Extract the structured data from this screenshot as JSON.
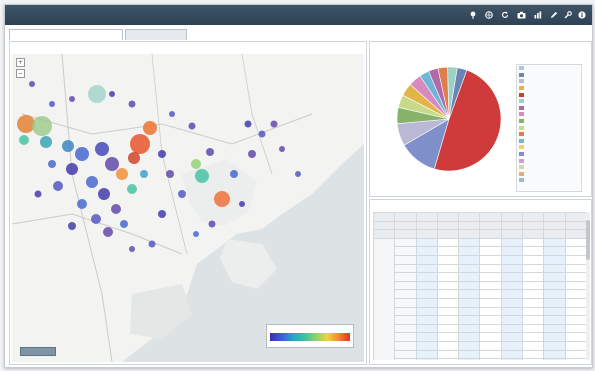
{
  "titlebar": {
    "title": "",
    "tools": [
      {
        "icon": "pin-icon",
        "label": ""
      },
      {
        "icon": "globe-icon",
        "label": ""
      },
      {
        "icon": "refresh-icon",
        "label": ""
      },
      {
        "icon": "camera-icon",
        "label": ""
      },
      {
        "icon": "bar-chart-icon",
        "label": ""
      },
      {
        "icon": "pencil-icon",
        "label": ""
      },
      {
        "icon": "wrench-icon",
        "label": ""
      },
      {
        "icon": "info-icon",
        "label": ""
      }
    ]
  },
  "tabs": [
    {
      "label": ""
    },
    {
      "label": ""
    }
  ],
  "map_panel": {
    "title": "",
    "attribution": "",
    "legend": {
      "min": "",
      "max": ""
    }
  },
  "pie_panel": {
    "title": "",
    "slices": [
      {
        "value": 49,
        "color": "#cf3b3b"
      },
      {
        "value": 12,
        "color": "#7f8fc9"
      },
      {
        "value": 7,
        "color": "#b9b9d6"
      },
      {
        "value": 5,
        "color": "#86b36a"
      },
      {
        "value": 4,
        "color": "#c9d98a"
      },
      {
        "value": 4,
        "color": "#e3b44a"
      },
      {
        "value": 4,
        "color": "#d88ac0"
      },
      {
        "value": 3,
        "color": "#6fb6d6"
      },
      {
        "value": 3,
        "color": "#b06aa8"
      },
      {
        "value": 3,
        "color": "#e07d4c"
      },
      {
        "value": 3,
        "color": "#9fd0c6"
      },
      {
        "value": 3,
        "color": "#6a84b8"
      }
    ],
    "legend": [
      {
        "label": "",
        "color": "#a9c7e8"
      },
      {
        "label": "",
        "color": "#6a84b8"
      },
      {
        "label": "",
        "color": "#b9b9d6"
      },
      {
        "label": "",
        "color": "#e3b44a"
      },
      {
        "label": "",
        "color": "#cf3b3b"
      },
      {
        "label": "",
        "color": "#9fd0c6"
      },
      {
        "label": "",
        "color": "#b06aa8"
      },
      {
        "label": "",
        "color": "#d88ac0"
      },
      {
        "label": "",
        "color": "#86b36a"
      },
      {
        "label": "",
        "color": "#c9d98a"
      },
      {
        "label": "",
        "color": "#e07d4c"
      },
      {
        "label": "",
        "color": "#6fb6d6"
      },
      {
        "label": "",
        "color": "#f0d070"
      },
      {
        "label": "",
        "color": "#7f8fc9"
      },
      {
        "label": "",
        "color": "#c7a0d0"
      },
      {
        "label": "",
        "color": "#d8d8a0"
      },
      {
        "label": "",
        "color": "#e8a878"
      },
      {
        "label": "",
        "color": "#a0b8d0"
      }
    ],
    "pager": ""
  },
  "table_panel": {
    "title": "",
    "header_rows": [
      [
        "",
        "",
        "",
        "",
        "",
        "",
        "",
        "",
        "",
        ""
      ],
      [
        "",
        "",
        "",
        "",
        "",
        "",
        "",
        "",
        "",
        ""
      ],
      [
        "",
        "",
        "",
        "",
        "",
        "",
        "",
        "",
        "",
        ""
      ]
    ],
    "groups": [
      {
        "label": "",
        "rows": [
          {
            "label": "",
            "cells": [
              "",
              "",
              "",
              "",
              "",
              "",
              "",
              ""
            ]
          },
          {
            "label": "",
            "cells": [
              "",
              "",
              "",
              "",
              "",
              "",
              "",
              ""
            ]
          },
          {
            "label": "",
            "cells": [
              "",
              "",
              "",
              "",
              "",
              "",
              "",
              ""
            ]
          },
          {
            "label": "",
            "cells": [
              "",
              "",
              "",
              "",
              "",
              "",
              "",
              ""
            ]
          },
          {
            "label": "",
            "cells": [
              "",
              "",
              "",
              "",
              "",
              "",
              "",
              ""
            ]
          },
          {
            "label": "",
            "cells": [
              "",
              "",
              "",
              "",
              "",
              "",
              "",
              ""
            ]
          },
          {
            "label": "",
            "cells": [
              "",
              "",
              "",
              "",
              "",
              "",
              "",
              ""
            ]
          },
          {
            "label": "",
            "cells": [
              "",
              "",
              "",
              "",
              "",
              "",
              "",
              ""
            ]
          },
          {
            "label": "",
            "cells": [
              "",
              "",
              "",
              "",
              "",
              "",
              "",
              ""
            ]
          },
          {
            "label": "",
            "cells": [
              "",
              "",
              "",
              "",
              "",
              "",
              "",
              ""
            ]
          },
          {
            "label": "",
            "cells": [
              "",
              "",
              "",
              "",
              "",
              "",
              "",
              ""
            ]
          },
          {
            "label": "",
            "cells": [
              "",
              "",
              "",
              "",
              "",
              "",
              "",
              ""
            ]
          },
          {
            "label": "",
            "cells": [
              "",
              "",
              "",
              "",
              "",
              "",
              "",
              ""
            ]
          },
          {
            "label": "",
            "cells": [
              "",
              "",
              "",
              "",
              "",
              "",
              "",
              ""
            ]
          },
          {
            "label": "",
            "cells": [
              "",
              "",
              "",
              "",
              "",
              "",
              "",
              ""
            ]
          },
          {
            "label": "",
            "cells": [
              "",
              "",
              "",
              "",
              "",
              "",
              "",
              ""
            ]
          }
        ]
      }
    ]
  }
}
